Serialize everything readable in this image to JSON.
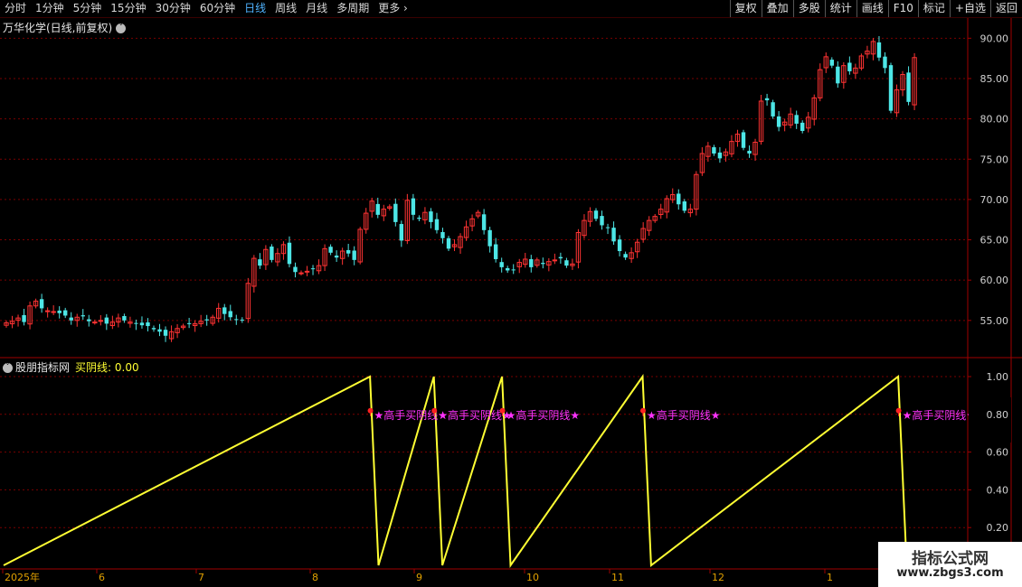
{
  "toolbar": {
    "periods": [
      {
        "label": "分时",
        "active": false
      },
      {
        "label": "1分钟",
        "active": false
      },
      {
        "label": "5分钟",
        "active": false
      },
      {
        "label": "15分钟",
        "active": false
      },
      {
        "label": "30分钟",
        "active": false
      },
      {
        "label": "60分钟",
        "active": false
      },
      {
        "label": "日线",
        "active": true
      },
      {
        "label": "周线",
        "active": false
      },
      {
        "label": "月线",
        "active": false
      },
      {
        "label": "多周期",
        "active": false
      },
      {
        "label": "更多",
        "active": false
      }
    ],
    "buttons": [
      "复权",
      "叠加",
      "多股",
      "统计",
      "画线",
      "F10",
      "标记",
      "+自选",
      "返回"
    ]
  },
  "chart_title": "万华化学(日线,前复权)",
  "indicator": {
    "name": "股朋指标网",
    "series_label": "买阴线:",
    "series_value": "0.00"
  },
  "colors": {
    "up": "#ff3333",
    "down": "#4de6e6",
    "signal_line": "#ffff33",
    "signal_text": "#ff33ff",
    "grid": "#7a0000",
    "axis_text": "#d0d0d0"
  },
  "chart_data": [
    {
      "type": "candlestick",
      "title": "万华化学(日线,前复权)",
      "y_ticks": [
        "90.00",
        "85.00",
        "80.00",
        "75.00",
        "70.00",
        "65.00",
        "60.00",
        "55.00"
      ],
      "ylim": [
        50.5,
        92.5
      ],
      "grid": true,
      "closes": [
        54.7,
        54.9,
        55.3,
        54.8,
        56.8,
        57.4,
        56.5,
        56.2,
        56.1,
        55.9,
        55.6,
        55.0,
        55.4,
        55.5,
        54.9,
        54.8,
        55.0,
        54.6,
        54.8,
        55.3,
        55.0,
        54.8,
        54.6,
        54.4,
        54.3,
        53.9,
        53.6,
        53.1,
        53.6,
        54.0,
        54.3,
        54.6,
        54.6,
        54.9,
        55.0,
        55.4,
        56.5,
        55.8,
        55.4,
        55.1,
        55.0,
        59.6,
        62.7,
        61.8,
        63.8,
        62.5,
        63.3,
        64.4,
        62.0,
        61.0,
        60.9,
        61.1,
        61.4,
        61.8,
        63.9,
        63.4,
        62.8,
        63.6,
        63.3,
        62.5,
        66.3,
        68.3,
        69.8,
        68.1,
        68.8,
        69.1,
        67.2,
        64.9,
        69.9,
        68.1,
        67.6,
        68.4,
        67.2,
        66.2,
        65.2,
        63.9,
        64.4,
        65.4,
        66.6,
        67.6,
        68.4,
        66.2,
        64.2,
        62.6,
        61.6,
        61.2,
        61.3,
        62.2,
        62.6,
        61.6,
        62.5,
        62.0,
        62.3,
        62.5,
        62.7,
        61.8,
        62.0,
        65.9,
        67.4,
        68.5,
        67.6,
        66.8,
        66.5,
        64.8,
        63.6,
        62.8,
        63.4,
        64.7,
        66.4,
        67.4,
        67.9,
        68.8,
        70.1,
        70.6,
        69.4,
        68.6,
        68.8,
        73.1,
        75.7,
        76.6,
        75.7,
        75.1,
        75.9,
        77.2,
        78.1,
        76.4,
        75.7,
        77.1,
        82.2,
        82.3,
        80.3,
        79.0,
        79.6,
        80.6,
        79.4,
        78.5,
        80.2,
        82.6,
        86.1,
        87.7,
        86.6,
        84.4,
        86.6,
        85.9,
        86.3,
        87.8,
        88.4,
        89.6,
        87.6,
        86.3,
        81.0,
        83.6,
        85.5,
        82.1,
        87.6
      ],
      "x_ticks": [
        "2025年",
        "6",
        "7",
        "8",
        "9",
        "10",
        "11",
        "12",
        "1"
      ]
    },
    {
      "type": "line",
      "series": [
        {
          "name": "买阴线",
          "values": [
            0,
            1,
            0,
            1,
            0,
            1,
            0,
            1,
            0,
            1,
            0
          ]
        }
      ],
      "x": [
        0,
        86,
        88,
        101,
        103,
        117,
        119,
        150,
        152,
        210,
        212
      ],
      "y_ticks": [
        "1.00",
        "0.80",
        "0.60",
        "0.40",
        "0.20"
      ],
      "ylim": [
        0,
        1
      ],
      "annotations": [
        "★高手买阴线★",
        "★高手买阴线★",
        "★高手买阴线★",
        "★高手买阴线★",
        "★高手买阴线★"
      ]
    }
  ]
}
